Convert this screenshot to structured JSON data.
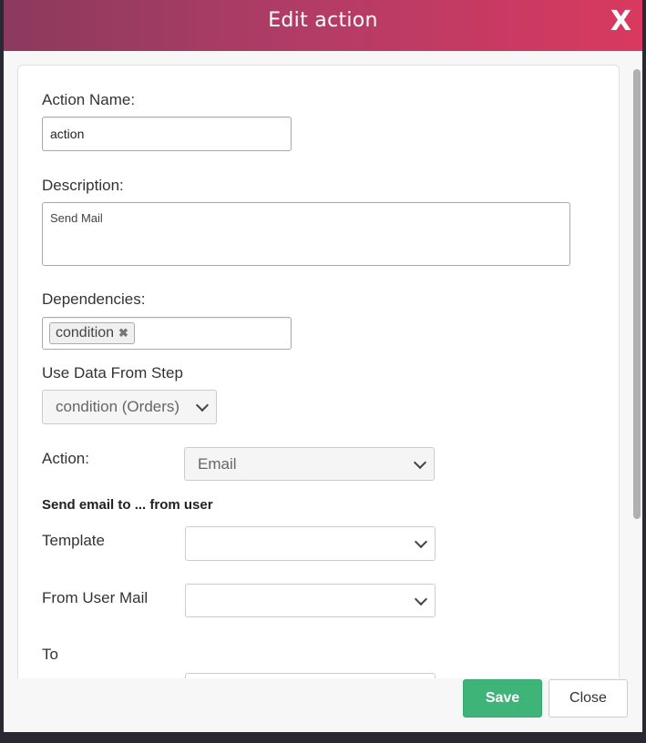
{
  "modal": {
    "title": "Edit action",
    "close_glyph": "X"
  },
  "form": {
    "action_name_label": "Action Name:",
    "action_name_value": "action",
    "description_label": "Description:",
    "description_value": "Send Mail",
    "dependencies_label": "Dependencies:",
    "dependency_tags": [
      {
        "label": "condition",
        "remove_glyph": "✖"
      }
    ],
    "use_data_label": "Use Data From Step",
    "use_data_value": "condition (Orders)",
    "action_label": "Action:",
    "action_value": "Email",
    "send_email_heading": "Send email to ... from user",
    "template_label": "Template",
    "template_value": "",
    "from_user_mail_label": "From User Mail",
    "from_user_mail_value": "",
    "to_label": "To"
  },
  "footer": {
    "save_label": "Save",
    "close_label": "Close"
  },
  "colors": {
    "header_gradient_start": "#8b3a5d",
    "header_gradient_end": "#d9395f",
    "save_button": "#3fb478"
  }
}
